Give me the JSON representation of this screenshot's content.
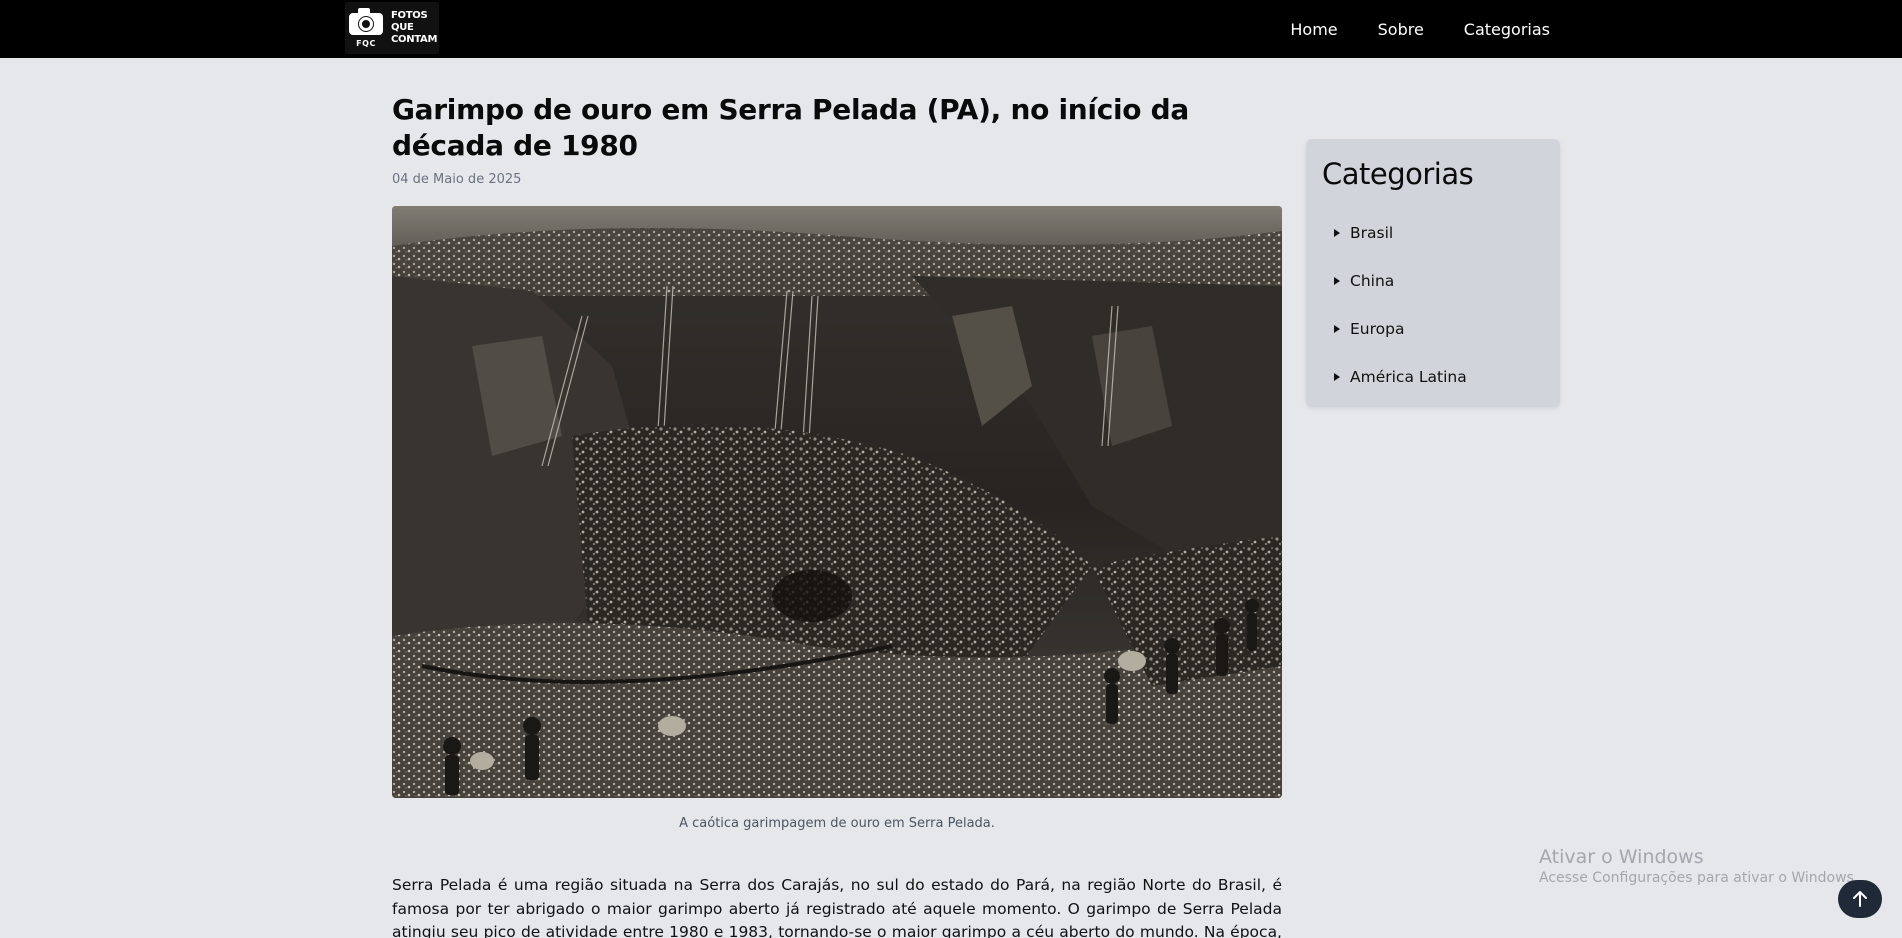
{
  "navbar": {
    "logo": {
      "lines": [
        "FOTOS",
        "QUE",
        "CONTAM"
      ],
      "abbr": "FQC",
      "icon": "camera-icon"
    },
    "links": [
      "Home",
      "Sobre",
      "Categorias"
    ]
  },
  "article": {
    "title": "Garimpo de ouro em Serra Pelada (PA), no início da década de 1980",
    "date": "04 de Maio de 2025",
    "image_alt": "A caótica garimpagem de ouro em Serra Pelada.",
    "caption": "A caótica garimpagem de ouro em Serra Pelada.",
    "body": "Serra Pelada é uma região situada na Serra dos Carajás, no sul do estado do Pará, na região Norte do Brasil, é famosa por ter abrigado o maior garimpo aberto já registrado até aquele momento. O garimpo de Serra Pelada atingiu seu pico de atividade entre 1980 e 1983, tornando-se o maior garimpo a céu aberto do mundo. Na época, milhares de garimpeiros"
  },
  "sidebar": {
    "title": "Categorias",
    "items": [
      "Brasil",
      "China",
      "Europa",
      "América Latina"
    ]
  },
  "watermark": {
    "title": "Ativar o Windows",
    "subtitle": "Acesse Configurações para ativar o Windows."
  },
  "back_to_top": {
    "icon": "arrow-up-icon"
  },
  "colors": {
    "navbar_bg": "#000000",
    "page_bg": "#e5e7eb",
    "sidebar_bg": "#d1d5db",
    "back_to_top_bg": "#1f2937"
  }
}
